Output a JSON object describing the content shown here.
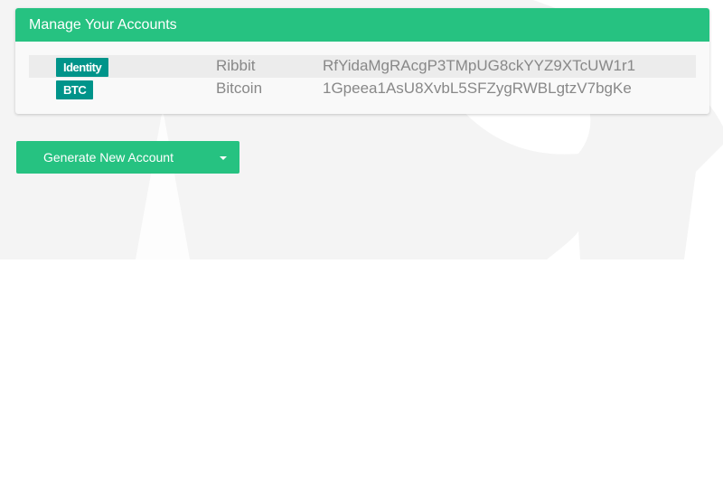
{
  "panel": {
    "title": "Manage Your Accounts"
  },
  "accounts": [
    {
      "type": "Identity",
      "name": "Ribbit",
      "address": "RfYidaMgRAcgP3TMpUG8ckYYZ9XTcUW1r1"
    },
    {
      "type": "BTC",
      "name": "Bitcoin",
      "address": "1Gpeea1AsU8XvbL5SFZygRWBLgtzV7bgKe"
    }
  ],
  "generate": {
    "label": "Generate New Account"
  },
  "colors": {
    "accent": "#26c281",
    "badge": "#00948a"
  }
}
